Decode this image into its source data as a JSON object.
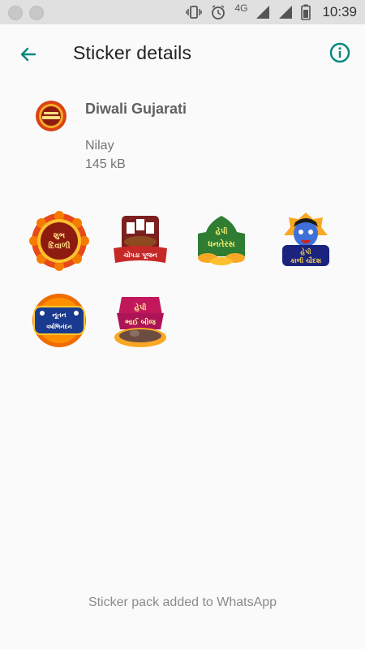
{
  "status_bar": {
    "network": "4G",
    "time": "10:39"
  },
  "app_bar": {
    "title": "Sticker details",
    "back_icon": "arrow-left-icon",
    "info_icon": "info-icon"
  },
  "pack": {
    "name": "Diwali Gujarati",
    "publisher": "Nilay",
    "size": "145 kB"
  },
  "stickers": [
    {
      "name": "shubh-diwali",
      "line1": "શુભ",
      "line2": "દિવાળી"
    },
    {
      "name": "chopda-pujan",
      "line1": "ચોપડા પૂજન"
    },
    {
      "name": "happy-dhanteras",
      "line1": "હેપી",
      "line2": "ધનતેરસ"
    },
    {
      "name": "happy-kali-chaudash",
      "line1": "હેપી",
      "line2": "કાળી ચૌદશ"
    },
    {
      "name": "nutan-varshabhinandan",
      "line1": "નૂતન",
      "line2": "વર્ષાભિનંદન"
    },
    {
      "name": "happy-bhai-beej",
      "line1": "હેપી",
      "line2": "ભાઈ બીજ"
    }
  ],
  "footer": {
    "message": "Sticker pack added to WhatsApp"
  },
  "colors": {
    "accent": "#00897B",
    "status_bar_bg": "#e0e0e0",
    "background": "#fafafa"
  }
}
